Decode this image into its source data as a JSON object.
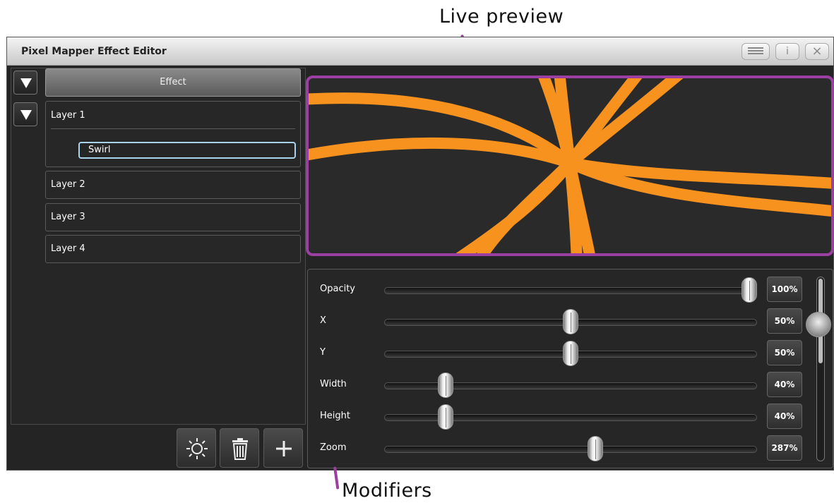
{
  "callouts": {
    "live_preview": "Live preview",
    "modifiers": "Modifiers"
  },
  "window": {
    "title": "Pixel Mapper Effect Editor",
    "info_label": "i",
    "close_label": "×"
  },
  "left_panel": {
    "effect_label": "Effect",
    "layers": [
      {
        "label": "Layer 1",
        "selected_effect": "Swirl"
      },
      {
        "label": "Layer 2"
      },
      {
        "label": "Layer 3"
      },
      {
        "label": "Layer 4"
      }
    ],
    "toolbar_icons": [
      "brightness-icon",
      "trash-icon",
      "plus-icon"
    ]
  },
  "preview": {
    "accent_color": "#9b3fa2",
    "line_color": "#f7921e"
  },
  "modifiers": [
    {
      "label": "Opacity",
      "value": "100%",
      "level": 1.0
    },
    {
      "label": "X",
      "value": "50%",
      "level": 0.5
    },
    {
      "label": "Y",
      "value": "50%",
      "level": 0.5
    },
    {
      "label": "Width",
      "value": "40%",
      "level": 0.15
    },
    {
      "label": "Height",
      "value": "40%",
      "level": 0.15
    },
    {
      "label": "Zoom",
      "value": "287%",
      "level": 0.57
    }
  ]
}
